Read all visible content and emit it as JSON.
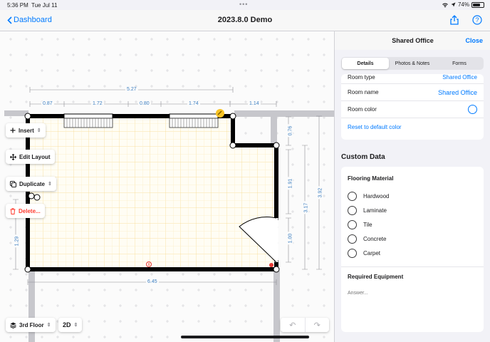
{
  "status_bar": {
    "time": "5:36 PM",
    "date": "Tue Jul 11",
    "battery": "74%"
  },
  "nav": {
    "back_label": "Dashboard",
    "title": "2023.8.0 Demo"
  },
  "toolbar": {
    "insert": "Insert",
    "edit_layout": "Edit Layout",
    "duplicate": "Duplicate",
    "delete": "Delete..."
  },
  "bottom": {
    "floor": "3rd Floor",
    "view_mode": "2D"
  },
  "dimensions": {
    "top_total": "5.27",
    "top_segments": [
      "0.87",
      "1.72",
      "0.80",
      "1.74",
      "1.14"
    ],
    "right_upper": "0.76",
    "right_mid": "1.91",
    "right_door": "1.00",
    "right_total_inner": "3.17",
    "right_total_outer": "3.92",
    "left_lower": "1.29",
    "bottom_total": "6.45"
  },
  "panel": {
    "title": "Shared Office",
    "close": "Close",
    "tabs": [
      {
        "label": "Details",
        "active": true
      },
      {
        "label": "Photos & Notes",
        "active": false
      },
      {
        "label": "Forms",
        "active": false
      }
    ],
    "room_type_label": "Room type",
    "room_type_value": "Shared Office",
    "room_name_label": "Room name",
    "room_name_value": "Shared Office",
    "room_color_label": "Room color",
    "reset_color": "Reset to default color",
    "custom_data_title": "Custom Data",
    "flooring_label": "Flooring Material",
    "flooring_options": [
      "Hardwood",
      "Laminate",
      "Tile",
      "Concrete",
      "Carpet"
    ],
    "equipment_label": "Required Equipment",
    "answer_placeholder": "Answer..."
  },
  "colors": {
    "accent": "#007aff",
    "dimension": "#3d7fc1",
    "delete": "#ff3b30",
    "wall": "#000000",
    "floor_grid": "#f6d88a"
  }
}
